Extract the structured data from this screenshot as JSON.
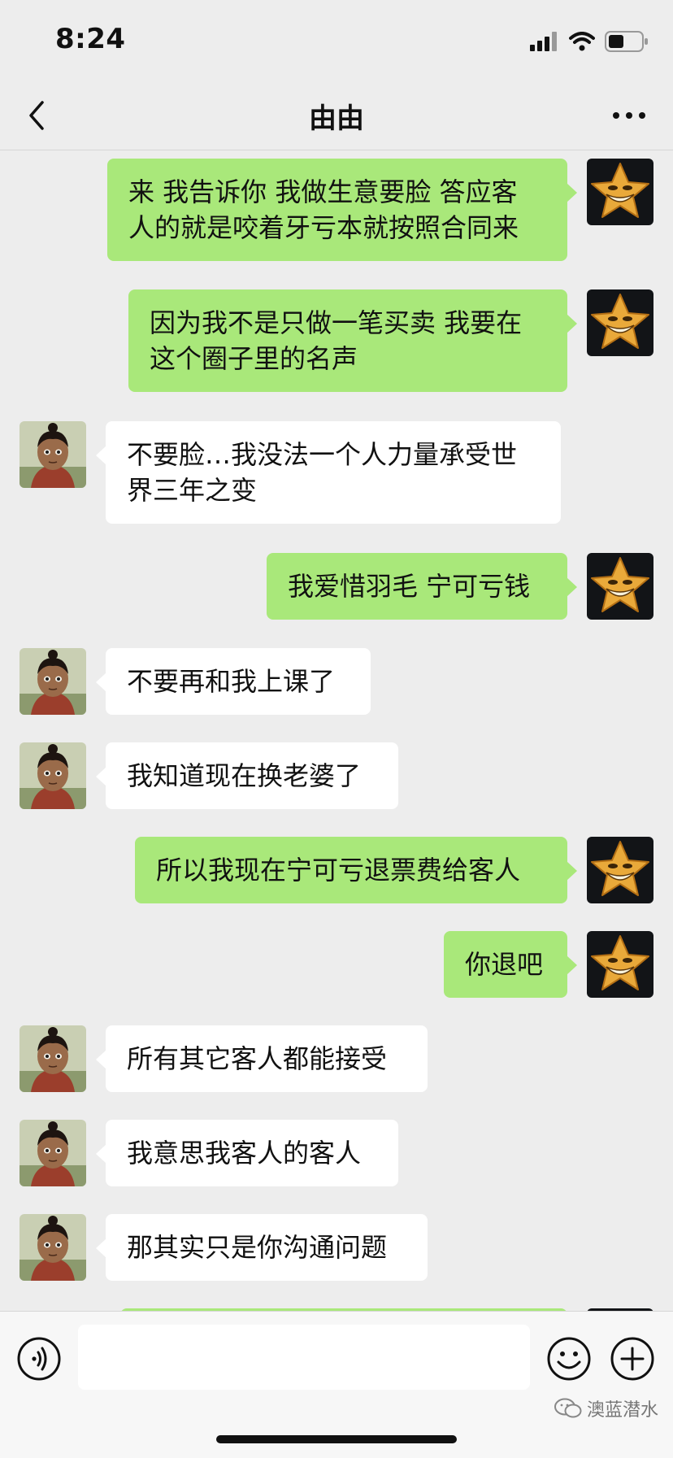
{
  "status_bar": {
    "time": "8:24"
  },
  "header": {
    "title": "由由"
  },
  "messages": [
    {
      "side": "right",
      "lines": [
        "来 我告诉你 我做生意要脸 答应客",
        "人的就是咬着牙亏本就按照合同来"
      ]
    },
    {
      "side": "right",
      "lines": [
        "因为我不是只做一笔买卖 我要在",
        "这个圈子里的名声"
      ]
    },
    {
      "side": "left",
      "lines": [
        "不要脸…我没法一个人力量承受世",
        "界三年之变"
      ]
    },
    {
      "side": "right",
      "lines": [
        "我爱惜羽毛 宁可亏钱"
      ]
    },
    {
      "side": "left",
      "lines": [
        "不要再和我上课了"
      ]
    },
    {
      "side": "left",
      "lines": [
        "我知道现在换老婆了"
      ]
    },
    {
      "side": "right",
      "lines": [
        "所以我现在宁可亏退票费给客人"
      ]
    },
    {
      "side": "right",
      "lines": [
        "你退吧"
      ]
    },
    {
      "side": "left",
      "lines": [
        "所有其它客人都能接受"
      ]
    },
    {
      "side": "left",
      "lines": [
        "我意思我客人的客人"
      ]
    },
    {
      "side": "left",
      "lines": [
        "那其实只是你沟通问题"
      ]
    }
  ],
  "watermark": {
    "text": "澳蓝潜水"
  },
  "colors": {
    "self_bubble": "#a9e87a",
    "other_bubble": "#ffffff",
    "background": "#ededed"
  },
  "icons": {
    "back": "chevron-left-icon",
    "more": "more-dots-icon",
    "voice": "voice-icon",
    "emoji": "emoji-icon",
    "plus": "plus-icon"
  }
}
